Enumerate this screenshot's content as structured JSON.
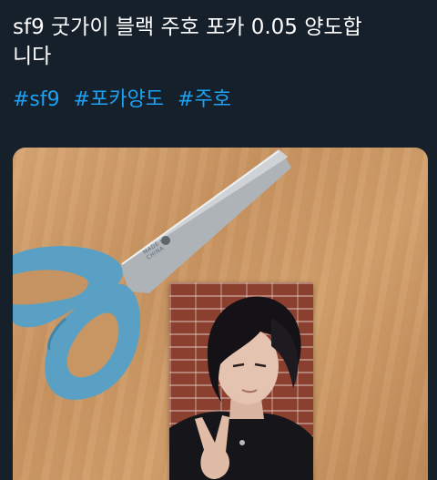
{
  "tweet": {
    "text_line1": "sf9 굿가이 블랙 주호 포카 0.05 양도합",
    "text_line2": "니다",
    "hashtags": [
      "#sf9",
      "#포카양도",
      "#주호"
    ]
  },
  "media": {
    "scissors_print_line1": "MADE IN",
    "scissors_print_line2": "CHINA"
  },
  "colors": {
    "background": "#15202b",
    "text": "#ffffff",
    "hashtag": "#1da1f2"
  }
}
